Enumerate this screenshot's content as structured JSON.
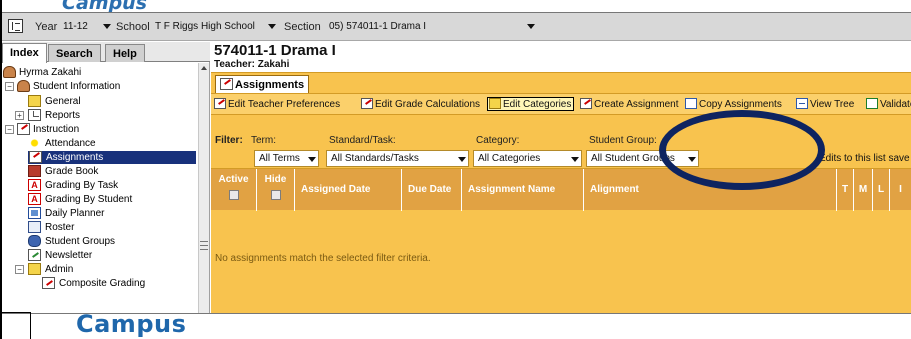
{
  "brand": {
    "top_text": "Campus",
    "bottom_text": "Campus"
  },
  "topbar": {
    "year_label": "Year",
    "year_value": "11-12",
    "school_label": "School",
    "school_value": "T F Riggs High School",
    "section_label": "Section",
    "section_value": "05) 574011-1 Drama I"
  },
  "sidebar": {
    "tabs": [
      "Index",
      "Search",
      "Help"
    ],
    "tree": [
      {
        "label": "Hyrma Zakahi",
        "icon": "person-icon"
      },
      {
        "label": "Student Information",
        "icon": "person-icon"
      },
      {
        "label": "General",
        "icon": "folder-icon"
      },
      {
        "label": "Reports",
        "icon": "page-icon"
      },
      {
        "label": "Instruction",
        "icon": "assign-icon"
      },
      {
        "label": "Attendance",
        "icon": "sun-icon"
      },
      {
        "label": "Assignments",
        "icon": "assign-icon"
      },
      {
        "label": "Grade Book",
        "icon": "grade-book-icon"
      },
      {
        "label": "Grading By Task",
        "icon": "task-icon"
      },
      {
        "label": "Grading By Student",
        "icon": "task-icon"
      },
      {
        "label": "Daily Planner",
        "icon": "planner-icon"
      },
      {
        "label": "Roster",
        "icon": "roster-icon"
      },
      {
        "label": "Student Groups",
        "icon": "groups-icon"
      },
      {
        "label": "Newsletter",
        "icon": "newsletter-icon"
      },
      {
        "label": "Admin",
        "icon": "admin-icon"
      },
      {
        "label": "Composite Grading",
        "icon": "composite-icon"
      }
    ],
    "expanders": {
      "minus": "−",
      "plus": "+"
    }
  },
  "page": {
    "title": "574011-1 Drama I",
    "teacher": "Teacher: Zakahi"
  },
  "subtab": {
    "label": "Assignments"
  },
  "toolbar": [
    {
      "label": "Edit Teacher Preferences",
      "icon": "edit-icon"
    },
    {
      "label": "Edit Grade Calculations",
      "icon": "edit-icon"
    },
    {
      "label": "Edit Categories",
      "icon": "folder-icon"
    },
    {
      "label": "Create Assignment",
      "icon": "edit-icon"
    },
    {
      "label": "Copy Assignments",
      "icon": "copy-icon"
    },
    {
      "label": "View Tree",
      "icon": "tree-icon"
    },
    {
      "label": "Validate",
      "icon": "validate-icon"
    }
  ],
  "filters": {
    "filter_label": "Filter:",
    "term_label": "Term:",
    "standard_label": "Standard/Task:",
    "category_label": "Category:",
    "group_label": "Student Group:",
    "term_value": "All Terms",
    "standard_value": "All Standards/Tasks",
    "category_value": "All Categories",
    "group_value": "All Student Groups",
    "autosave_note": "Edits to this list save automatically"
  },
  "table": {
    "columns": [
      "Active",
      "Hide",
      "Assigned Date",
      "Due Date",
      "Assignment Name",
      "Alignment",
      "T",
      "M",
      "L",
      "I"
    ],
    "empty_message": "No assignments match the selected filter criteria."
  },
  "colors": {
    "accent_orange": "#f8c34e",
    "header_orange": "#e1a243",
    "selection_navy": "#18317b",
    "highlight_oval": "#0e2460",
    "brand_blue": "#1f67ab"
  }
}
